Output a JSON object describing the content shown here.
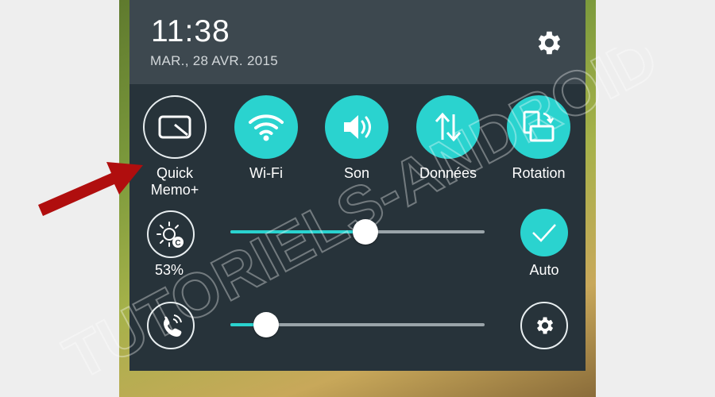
{
  "status": {
    "time": "11:38",
    "date": "MAR., 28 AVR. 2015"
  },
  "quick_settings": [
    {
      "id": "quickmemo",
      "label": "Quick\nMemo+",
      "icon": "quickmemo-icon",
      "active": false
    },
    {
      "id": "wifi",
      "label": "Wi-Fi",
      "icon": "wifi-icon",
      "active": true
    },
    {
      "id": "sound",
      "label": "Son",
      "icon": "sound-icon",
      "active": true
    },
    {
      "id": "data",
      "label": "Données",
      "icon": "data-transfer-icon",
      "active": true
    },
    {
      "id": "rotation",
      "label": "Rotation",
      "icon": "rotation-icon",
      "active": true
    }
  ],
  "brightness": {
    "percent_label": "53%",
    "value": 0.53,
    "auto_label": "Auto",
    "auto_enabled": true
  },
  "volume": {
    "value": 0.14
  },
  "watermark": "TUTORIELS-ANDROID",
  "colors": {
    "accent": "#2ad3cf",
    "panel": "#27333a",
    "header": "#3d484f",
    "arrow": "#b00e0e"
  }
}
